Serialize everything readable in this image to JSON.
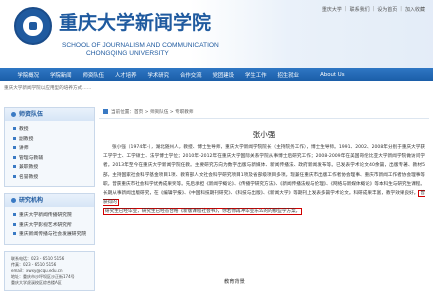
{
  "header": {
    "title_cn": "重庆大学新闻学院",
    "title_en_line1": "SCHOOL OF JOURNALISM AND COMMUNICATION",
    "title_en_line2": "CHONGQING UNIVERSITY",
    "top_links": [
      "重庆大学",
      "联系我们",
      "设为首页",
      "加入收藏"
    ]
  },
  "nav": [
    "学院概况",
    "学院新闻",
    "师资队伍",
    "人才培养",
    "学术研究",
    "合作交流",
    "党团建设",
    "学生工作",
    "招生就业",
    "About Us"
  ],
  "notice": "重庆大学新闻学院以应用型的培养方式……",
  "sidebar": {
    "box1_title": "师资队伍",
    "box1_items": [
      "教授",
      "副教授",
      "讲师",
      "管理与教辅",
      "兼职教授",
      "名誉教授"
    ],
    "box2_title": "研究机构",
    "box2_items": [
      "重庆大学新闻传播研究院",
      "重庆大学影视艺术研究所",
      "重庆新闻传播与社会发展研究院"
    ],
    "contact_lines": [
      "联系电话：023 - 6510 5156",
      "传真：023 - 6510 5156",
      "email：xwxy@cqu.edu.cn",
      "地址：重庆市沙坪坝区沙正街174号",
      "重庆大学虎溪校区综合楼A区"
    ]
  },
  "main": {
    "breadcrumb_prefix": "当前位置：",
    "breadcrumb": "首页 > 师资队伍 > 专职教师",
    "article_title": "张小强",
    "paragraph_1": "张小强（1974年-），湖北随州人，教授、博士生导师，重庆大学新闻学院院长（主持院务工作），博士生导师。1991、2002、2008年分别于重庆大学获工学学士、工学硕士、法学博士学位；2010年-2012年在重庆大学国际关系学院从事博士后研究工作；2008-2009年在美国哥伦比亚大学新闻学院做访问学者。2013年至今在重庆大学新闻学院任教。主要研究方向为数字出版与新媒体、新闻传播法、政府新闻发布等。已发表学术论文40余篇，出版专著、教材5部，主持国家社会科学基金项目1项、教育部人文社会科学研究项目1项及省部级项目多项。现兼任重庆市出版工作者协会理事、重庆市新闻工作者协会理事等职。曾获重庆市社会科学优秀成果奖等。先后承担《新闻学概论》、《传播学研究方法》、《新闻传播法规与伦理》、《网络与新媒体概论》等本科生与研究生课程。长期从事新闻出版研究，在《编辑学报》、《中国科技期刊研究》、《科技与出版》、《新闻大学》等期刊上发表多篇学术论文。科研成果丰富，教学效果良好。",
    "highlight_1": "曾获得的",
    "paragraph_2_lead": "研究生已经毕业，",
    "highlight_2": "研究生已经答合格《新版课程社会书》，你若你再冲毕业乐么的的那些学方案，",
    "paragraph_2_tail": "",
    "education_heading": "教育背景"
  }
}
